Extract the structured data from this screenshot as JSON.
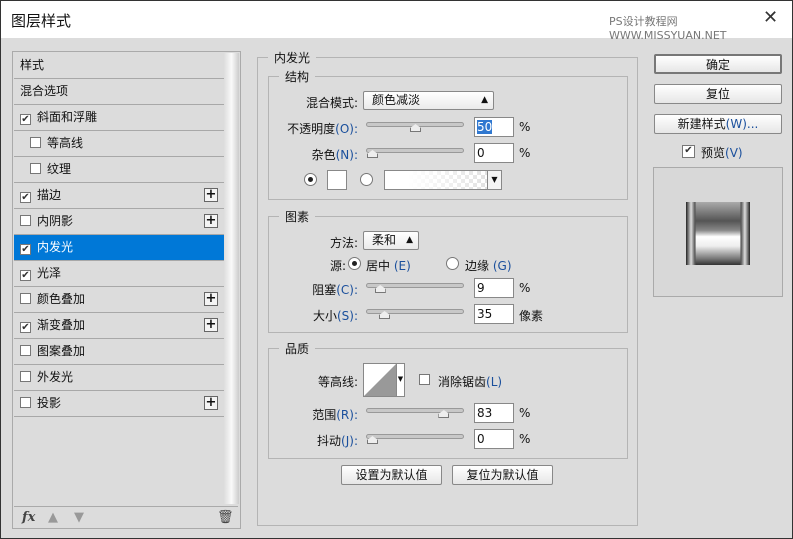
{
  "window": {
    "title": "图层样式",
    "watermark": "PS设计教程网  WWW.MISSYUAN.NET"
  },
  "sidebar": {
    "items": [
      {
        "label": "样式",
        "checkbox": null,
        "plus": false,
        "indent": false
      },
      {
        "label": "混合选项",
        "checkbox": null,
        "plus": false,
        "indent": false
      },
      {
        "label": "斜面和浮雕",
        "checkbox": true,
        "plus": false,
        "indent": false
      },
      {
        "label": "等高线",
        "checkbox": false,
        "plus": false,
        "indent": true
      },
      {
        "label": "纹理",
        "checkbox": false,
        "plus": false,
        "indent": true
      },
      {
        "label": "描边",
        "checkbox": true,
        "plus": true,
        "indent": false
      },
      {
        "label": "内阴影",
        "checkbox": false,
        "plus": true,
        "indent": false
      },
      {
        "label": "内发光",
        "checkbox": true,
        "plus": false,
        "indent": false,
        "selected": true
      },
      {
        "label": "光泽",
        "checkbox": true,
        "plus": false,
        "indent": false
      },
      {
        "label": "颜色叠加",
        "checkbox": false,
        "plus": true,
        "indent": false
      },
      {
        "label": "渐变叠加",
        "checkbox": true,
        "plus": true,
        "indent": false
      },
      {
        "label": "图案叠加",
        "checkbox": false,
        "plus": false,
        "indent": false
      },
      {
        "label": "外发光",
        "checkbox": false,
        "plus": false,
        "indent": false
      },
      {
        "label": "投影",
        "checkbox": false,
        "plus": true,
        "indent": false
      }
    ],
    "toolbar": {
      "fx": "fx",
      "up": "▲",
      "down": "▼",
      "trash": "🗑"
    }
  },
  "panel": {
    "title": "内发光",
    "structure": {
      "title": "结构",
      "blend_label": "混合模式:",
      "blend_value": "颜色减淡",
      "opacity_label": "不透明度",
      "opacity_key": "(O):",
      "opacity_value": "50",
      "opacity": 50,
      "noise_label": "杂色",
      "noise_key": "(N):",
      "noise_value": "0",
      "noise": 0,
      "pct": "%",
      "color_swatch": "#ffffff",
      "color_mode": "solid"
    },
    "elements": {
      "title": "图素",
      "method_label": "方法:",
      "method_value": "柔和",
      "source_label": "源:",
      "center_label": "居中",
      "center_key": "(E)",
      "edge_label": "边缘",
      "edge_key": "(G)",
      "source": "center",
      "choke_label": "阻塞",
      "choke_key": "(C):",
      "choke_value": "9",
      "choke": 9,
      "size_label": "大小",
      "size_key": "(S):",
      "size_value": "35",
      "size": 35,
      "size_unit": "像素",
      "pct": "%"
    },
    "quality": {
      "title": "品质",
      "contour_label": "等高线:",
      "antialias_label": "消除锯齿",
      "antialias_key": "(L)",
      "antialias": false,
      "range_label": "范围",
      "range_key": "(R):",
      "range_value": "83",
      "range": 83,
      "jitter_label": "抖动",
      "jitter_key": "(J):",
      "jitter_value": "0",
      "jitter": 0,
      "pct": "%"
    },
    "make_default": "设置为默认值",
    "reset_default": "复位为默认值"
  },
  "actions": {
    "ok": "确定",
    "reset": "复位",
    "new_style": "新建样式",
    "new_style_key": "(W)...",
    "preview_label": "预览",
    "preview_key": "(V)",
    "preview": true
  },
  "colors": {
    "selection": "#0078d7",
    "accent_key": "#1a4f9c"
  }
}
